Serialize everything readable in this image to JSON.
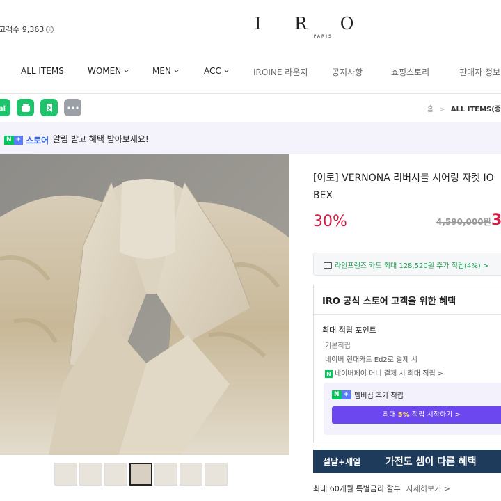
{
  "header": {
    "subscriber_label": "고객수 9,363",
    "info_icon": "info-icon",
    "logo_main": "I R O",
    "logo_sub": "PARIS"
  },
  "nav": {
    "items": [
      {
        "label": "ALL ITEMS",
        "dropdown": false
      },
      {
        "label": "WOMEN",
        "dropdown": true
      },
      {
        "label": "MEN",
        "dropdown": true
      },
      {
        "label": "ACC",
        "dropdown": true
      },
      {
        "label": "IROINE 라운지",
        "dropdown": false
      },
      {
        "label": "공지사항",
        "dropdown": false
      },
      {
        "label": "쇼핑스토리",
        "dropdown": false
      },
      {
        "label": "판매자 정보",
        "dropdown": false
      }
    ]
  },
  "share": {
    "icons": [
      "talk-icon",
      "chat-icon",
      "bookmark-icon",
      "more-icon"
    ]
  },
  "breadcrumb": {
    "home": "홈",
    "separator": ">",
    "current": "ALL ITEMS(종"
  },
  "banner": {
    "badge_n": "N",
    "badge_plus": "+",
    "store": "스토어",
    "message": "알림 받고 혜택 받아보세요!"
  },
  "gallery": {
    "thumbnail_count": 7,
    "selected_index": 3
  },
  "product": {
    "title_line1": "[이로] VERNONA 리버시블 시어링 자켓 IO",
    "title_line2": "BEX",
    "discount": "30%",
    "original_price": "4,590,000원",
    "sale_price": "3,"
  },
  "card_promo": {
    "text": "라인프렌즈 카드 최대 128,520원 추가 적립(4%) >"
  },
  "benefits": {
    "heading": "IRO 공식 스토어 고객을 위한 혜택",
    "max_points": "최대 적립 포인트",
    "rows": [
      "기본적립",
      "네이버 현대카드 Ed2로 결제 시",
      "네이버페이 머니 결제 시 최대 적립 >"
    ],
    "npay_badge": "N",
    "membership_badge_n": "N",
    "membership_badge_plus": "+",
    "membership_title": "멤버십 추가 적립",
    "membership_btn_prefix": "최대 ",
    "membership_btn_rate": "5%",
    "membership_btn_suffix": " 적립 시작하기 >"
  },
  "ad": {
    "left": "설날+세일",
    "right": "가전도 셈이 다른 혜택"
  },
  "installment": {
    "text": "최대 60개월 특별금리 할부",
    "link": "자세히보기 >"
  },
  "colors": {
    "accent_red": "#d11d44",
    "naver_green": "#03c75a",
    "membership_purple": "#6c47f0",
    "ad_navy": "#1f3b5c"
  }
}
